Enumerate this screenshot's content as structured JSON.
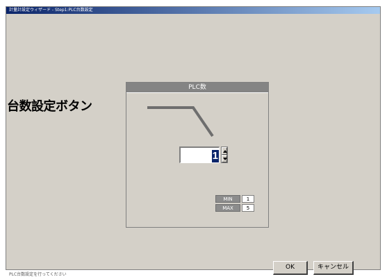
{
  "window": {
    "title": "計量計設定ウィザード - Step1:PLC台数設定",
    "status": "PLC台数設定を行ってください"
  },
  "panel": {
    "header": "PLC数",
    "count_value": "1",
    "min_label": "MIN",
    "min_value": "1",
    "max_label": "MAX",
    "max_value": "5"
  },
  "buttons": {
    "ok_label": "OK",
    "cancel_label": "キャンセル"
  },
  "annotation": {
    "label": "台数設定ボタン"
  },
  "colors": {
    "window_bg": "#d4d0c8",
    "header_bg": "#848484",
    "selection": "#0a246a",
    "callout_line": "#6e6e6e"
  }
}
